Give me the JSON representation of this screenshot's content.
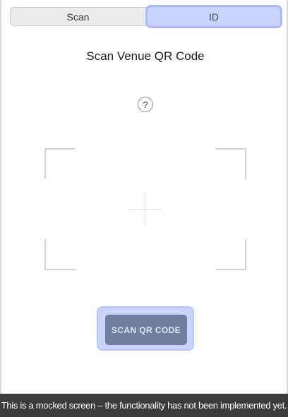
{
  "tabs": [
    {
      "label": "Scan",
      "selected": false
    },
    {
      "label": "ID",
      "selected": true
    }
  ],
  "title": "Scan Venue QR Code",
  "help_label": "?",
  "scan_button_label": "SCAN QR CODE",
  "banner_text": "This is a mocked screen – the functionality has not been implemented yet.",
  "colors": {
    "highlight": "#c9d3fb",
    "button": "#717ea0",
    "banner": "#3b3b3b"
  },
  "icons": {
    "help": "question-circle-icon",
    "viewfinder_center": "plus-crosshair-icon"
  }
}
